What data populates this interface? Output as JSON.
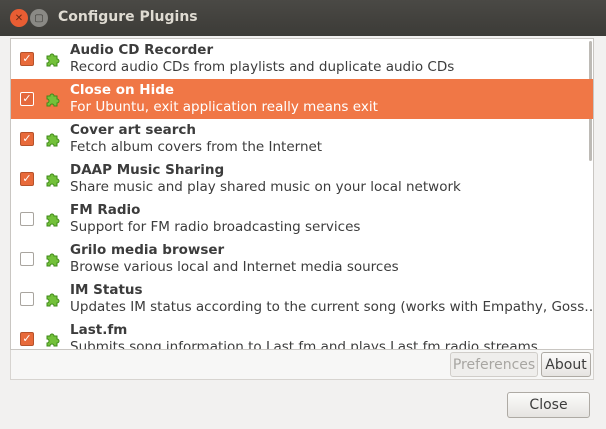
{
  "window": {
    "title": "Configure Plugins"
  },
  "plugins": [
    {
      "name": "Audio CD Recorder",
      "desc": "Record audio CDs from playlists and duplicate audio CDs",
      "checked": true
    },
    {
      "name": "Close on Hide",
      "desc": "For Ubuntu, exit application really means exit",
      "checked": true,
      "selected": true
    },
    {
      "name": "Cover art search",
      "desc": "Fetch album covers from the Internet",
      "checked": true
    },
    {
      "name": "DAAP Music Sharing",
      "desc": "Share music and play shared music on your local network",
      "checked": true
    },
    {
      "name": "FM Radio",
      "desc": "Support for FM radio broadcasting services",
      "checked": false
    },
    {
      "name": "Grilo media browser",
      "desc": "Browse various local and Internet media sources",
      "checked": false
    },
    {
      "name": "IM Status",
      "desc": "Updates IM status according to the current song (works with Empathy, Goss…",
      "checked": false
    },
    {
      "name": "Last.fm",
      "desc": "Submits song information to Last.fm and plays Last.fm radio streams",
      "checked": true
    }
  ],
  "buttons": {
    "preferences": "Preferences",
    "about": "About",
    "close": "Close"
  },
  "colors": {
    "accent": "#f07746",
    "titlebar": "#3c3b37"
  }
}
